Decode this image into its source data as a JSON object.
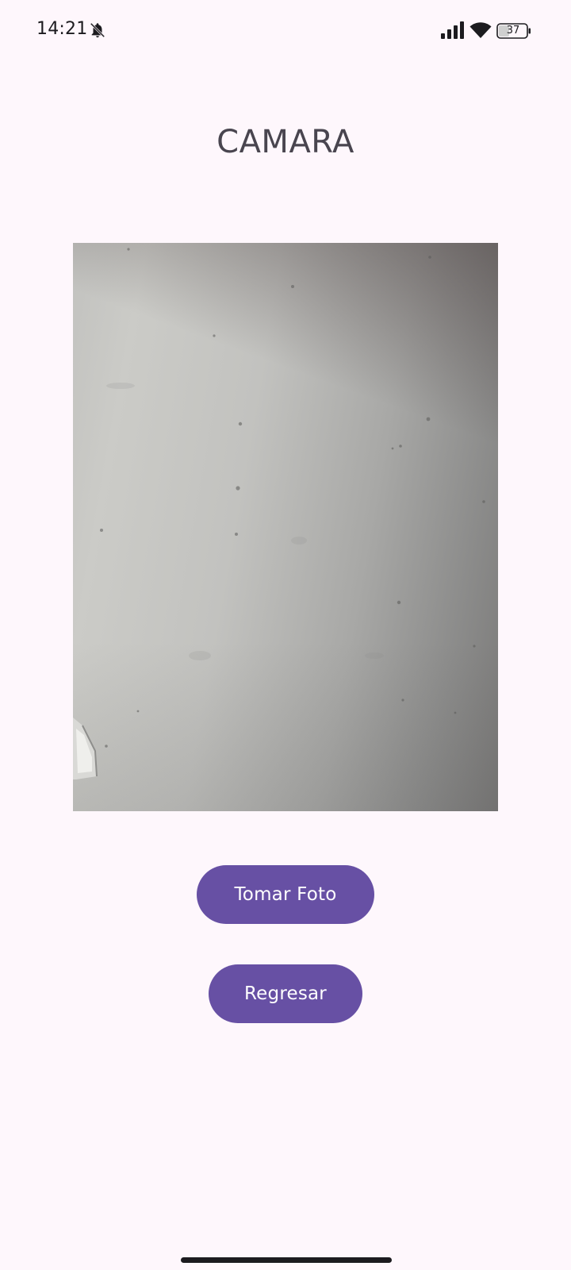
{
  "status_bar": {
    "time": "14:21",
    "battery": "37",
    "icons": [
      "bell-off-icon",
      "signal-icon",
      "wifi-icon",
      "battery-icon"
    ]
  },
  "screen": {
    "title": "CAMARA"
  },
  "camera": {
    "preview_icon": "camera-preview-image"
  },
  "buttons": {
    "take_photo": "Tomar Foto",
    "back": "Regresar"
  },
  "colors": {
    "background": "#fef7fc",
    "primary": "#6750a4",
    "on_primary": "#ffffff",
    "title_text": "#49454f"
  }
}
